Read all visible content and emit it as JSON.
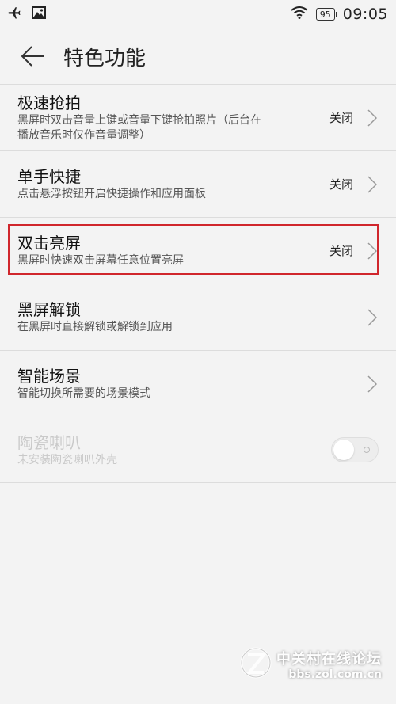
{
  "status_bar": {
    "battery": "95",
    "time": "09:05",
    "icons": [
      "airplane-icon",
      "image-icon",
      "wifi-icon",
      "battery-icon"
    ]
  },
  "header": {
    "title": "特色功能",
    "back_icon": "back-arrow-icon"
  },
  "items": [
    {
      "title": "极速抢拍",
      "subtitle_line1": "黑屏时双击音量上键或音量下键抢拍照片（后台在",
      "subtitle_line2": "播放音乐时仅作音量调整）",
      "status": "关闭"
    },
    {
      "title": "单手快捷",
      "subtitle": "点击悬浮按钮开启快捷操作和应用面板",
      "status": "关闭"
    },
    {
      "title": "双击亮屏",
      "subtitle": "黑屏时快速双击屏幕任意位置亮屏",
      "status": "关闭",
      "highlighted": true
    },
    {
      "title": "黑屏解锁",
      "subtitle": "在黑屏时直接解锁或解锁到应用"
    },
    {
      "title": "智能场景",
      "subtitle": "智能切换所需要的场景模式"
    },
    {
      "title": "陶瓷喇叭",
      "subtitle": "未安装陶瓷喇叭外壳",
      "toggle": "off",
      "disabled": true
    }
  ],
  "watermark": {
    "name": "中关村在线论坛",
    "url": "bbs.zol.com.cn"
  },
  "colors": {
    "background": "#f3f3f3",
    "highlight_border": "#d0262c",
    "disabled_text": "#c9c9c9"
  }
}
